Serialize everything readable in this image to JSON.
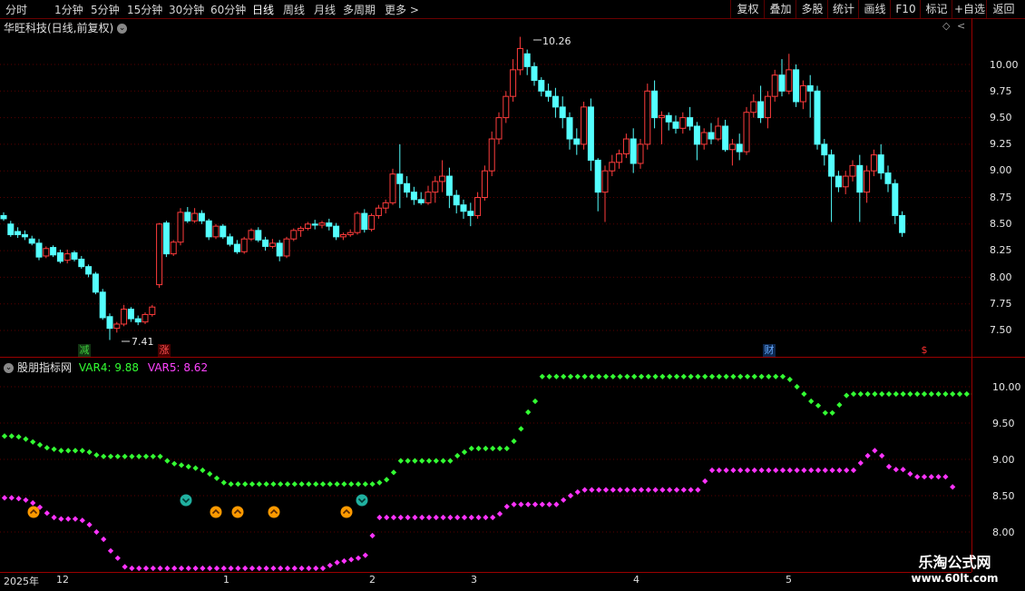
{
  "toolbar": {
    "periods": [
      "分时",
      "1分钟",
      "5分钟",
      "15分钟",
      "30分钟",
      "60分钟",
      "日线",
      "周线",
      "月线",
      "多周期",
      "更多 >"
    ],
    "active_period": "日线",
    "right_buttons": [
      "复权",
      "叠加",
      "多股",
      "统计",
      "画线",
      "F10",
      "标记",
      "+自选",
      "返回"
    ]
  },
  "main_chart": {
    "title": "华旺科技(日线,前复权)",
    "high_label": "10.26",
    "low_label": "7.41",
    "price_axis": [
      "10.00",
      "9.75",
      "9.50",
      "9.25",
      "9.00",
      "8.75",
      "8.50",
      "8.25",
      "8.00",
      "7.75",
      "7.50"
    ],
    "markers": [
      {
        "label": "减",
        "color": "#2ea02e",
        "bg": "#1a4a1a"
      },
      {
        "label": "涨",
        "color": "#ff4040",
        "bg": "#4a0000"
      },
      {
        "label": "财",
        "color": "#5aa0ff",
        "bg": "#102a50"
      },
      {
        "label": "$",
        "color": "#ff3030",
        "bg": "#000000"
      }
    ]
  },
  "indicator": {
    "name": "股朋指标网",
    "var4_label": "VAR4: 9.88",
    "var5_label": "VAR5: 8.62",
    "axis": [
      "10.00",
      "9.50",
      "9.00",
      "8.50",
      "8.00"
    ],
    "colors": {
      "var4": "#33ff33",
      "var5": "#ff33ff"
    }
  },
  "date_axis": [
    "2025年",
    "12",
    "1",
    "2",
    "3",
    "4",
    "5"
  ],
  "watermark": {
    "line1": "乐淘公式网",
    "line2": "www.60lt.com"
  },
  "chart_data": {
    "type": "candlestick",
    "ylim": [
      7.3,
      10.35
    ],
    "candles": [
      [
        8.58,
        8.61,
        8.55,
        8.53
      ],
      [
        8.5,
        8.53,
        8.4,
        8.38
      ],
      [
        8.43,
        8.47,
        8.4,
        8.37
      ],
      [
        8.4,
        8.44,
        8.38,
        8.35
      ],
      [
        8.36,
        8.39,
        8.32,
        8.3
      ],
      [
        8.32,
        8.36,
        8.19,
        8.16
      ],
      [
        8.2,
        8.29,
        8.27,
        8.18
      ],
      [
        8.28,
        8.3,
        8.21,
        8.19
      ],
      [
        8.23,
        8.26,
        8.15,
        8.13
      ],
      [
        8.16,
        8.26,
        8.22,
        8.13
      ],
      [
        8.23,
        8.25,
        8.17,
        8.15
      ],
      [
        8.17,
        8.2,
        8.1,
        8.08
      ],
      [
        8.1,
        8.12,
        8.03,
        8.0
      ],
      [
        8.03,
        8.05,
        7.86,
        7.84
      ],
      [
        7.86,
        7.89,
        7.62,
        7.6
      ],
      [
        7.63,
        7.66,
        7.52,
        7.41
      ],
      [
        7.52,
        7.58,
        7.56,
        7.48
      ],
      [
        7.56,
        7.74,
        7.7,
        7.54
      ],
      [
        7.7,
        7.72,
        7.61,
        7.58
      ],
      [
        7.61,
        7.64,
        7.58,
        7.55
      ],
      [
        7.58,
        7.67,
        7.65,
        7.56
      ],
      [
        7.65,
        7.74,
        7.72,
        7.63
      ],
      [
        7.93,
        8.51,
        8.5,
        7.9
      ],
      [
        8.51,
        8.53,
        8.22,
        8.19
      ],
      [
        8.22,
        8.35,
        8.33,
        8.2
      ],
      [
        8.33,
        8.65,
        8.61,
        8.3
      ],
      [
        8.61,
        8.66,
        8.53,
        8.51
      ],
      [
        8.53,
        8.65,
        8.6,
        8.51
      ],
      [
        8.6,
        8.63,
        8.53,
        8.5
      ],
      [
        8.53,
        8.55,
        8.38,
        8.35
      ],
      [
        8.38,
        8.5,
        8.48,
        8.36
      ],
      [
        8.48,
        8.5,
        8.38,
        8.36
      ],
      [
        8.38,
        8.41,
        8.31,
        8.29
      ],
      [
        8.31,
        8.35,
        8.24,
        8.22
      ],
      [
        8.24,
        8.38,
        8.36,
        8.22
      ],
      [
        8.36,
        8.46,
        8.44,
        8.34
      ],
      [
        8.44,
        8.47,
        8.35,
        8.33
      ],
      [
        8.35,
        8.38,
        8.29,
        8.25
      ],
      [
        8.29,
        8.36,
        8.32,
        8.27
      ],
      [
        8.32,
        8.35,
        8.2,
        8.15
      ],
      [
        8.2,
        8.38,
        8.36,
        8.18
      ],
      [
        8.36,
        8.46,
        8.44,
        8.34
      ],
      [
        8.44,
        8.48,
        8.46,
        8.38
      ],
      [
        8.46,
        8.52,
        8.5,
        8.44
      ],
      [
        8.5,
        8.54,
        8.49,
        8.45
      ],
      [
        8.49,
        8.53,
        8.51,
        8.46
      ],
      [
        8.51,
        8.55,
        8.48,
        8.44
      ],
      [
        8.48,
        8.51,
        8.38,
        8.35
      ],
      [
        8.38,
        8.42,
        8.4,
        8.35
      ],
      [
        8.4,
        8.45,
        8.42,
        8.38
      ],
      [
        8.42,
        8.62,
        8.6,
        8.4
      ],
      [
        8.6,
        8.64,
        8.45,
        8.42
      ],
      [
        8.45,
        8.6,
        8.58,
        8.43
      ],
      [
        8.58,
        8.68,
        8.65,
        8.55
      ],
      [
        8.65,
        8.73,
        8.7,
        8.6
      ],
      [
        8.7,
        9.02,
        8.97,
        8.68
      ],
      [
        8.97,
        9.25,
        8.88,
        8.65
      ],
      [
        8.88,
        8.95,
        8.8,
        8.75
      ],
      [
        8.8,
        8.85,
        8.73,
        8.68
      ],
      [
        8.73,
        8.8,
        8.7,
        8.68
      ],
      [
        8.7,
        8.86,
        8.8,
        8.68
      ],
      [
        8.8,
        8.95,
        8.9,
        8.7
      ],
      [
        8.9,
        9.1,
        8.95,
        8.8
      ],
      [
        8.95,
        9.03,
        8.77,
        8.65
      ],
      [
        8.77,
        8.82,
        8.68,
        8.6
      ],
      [
        8.68,
        8.73,
        8.62,
        8.55
      ],
      [
        8.62,
        8.7,
        8.58,
        8.48
      ],
      [
        8.58,
        8.8,
        8.75,
        8.55
      ],
      [
        8.75,
        9.05,
        9.0,
        8.72
      ],
      [
        9.0,
        9.37,
        9.3,
        8.95
      ],
      [
        9.3,
        9.55,
        9.5,
        9.25
      ],
      [
        9.5,
        9.75,
        9.7,
        9.45
      ],
      [
        9.7,
        10.05,
        9.95,
        9.65
      ],
      [
        9.95,
        10.26,
        10.15,
        9.9
      ],
      [
        10.1,
        10.14,
        9.98,
        9.9
      ],
      [
        9.98,
        10.02,
        9.85,
        9.8
      ],
      [
        9.85,
        9.88,
        9.75,
        9.7
      ],
      [
        9.75,
        9.82,
        9.7,
        9.65
      ],
      [
        9.7,
        9.78,
        9.6,
        9.5
      ],
      [
        9.6,
        9.7,
        9.5,
        9.4
      ],
      [
        9.5,
        9.55,
        9.3,
        9.2
      ],
      [
        9.3,
        9.4,
        9.25,
        9.15
      ],
      [
        9.25,
        9.65,
        9.6,
        9.2
      ],
      [
        9.6,
        9.68,
        9.1,
        9.0
      ],
      [
        9.1,
        9.12,
        8.8,
        8.62
      ],
      [
        8.8,
        9.05,
        9.0,
        8.52
      ],
      [
        9.0,
        9.15,
        9.08,
        8.95
      ],
      [
        9.08,
        9.2,
        9.16,
        9.02
      ],
      [
        9.16,
        9.35,
        9.3,
        9.12
      ],
      [
        9.3,
        9.4,
        9.07,
        8.98
      ],
      [
        9.07,
        9.3,
        9.25,
        9.02
      ],
      [
        9.25,
        9.82,
        9.75,
        9.2
      ],
      [
        9.75,
        9.85,
        9.5,
        9.4
      ],
      [
        9.5,
        9.56,
        9.52,
        9.25
      ],
      [
        9.52,
        9.55,
        9.46,
        9.38
      ],
      [
        9.46,
        9.52,
        9.4,
        9.35
      ],
      [
        9.4,
        9.55,
        9.5,
        9.35
      ],
      [
        9.5,
        9.6,
        9.42,
        9.38
      ],
      [
        9.42,
        9.46,
        9.25,
        9.1
      ],
      [
        9.25,
        9.4,
        9.36,
        9.2
      ],
      [
        9.36,
        9.45,
        9.3,
        9.25
      ],
      [
        9.3,
        9.5,
        9.42,
        9.28
      ],
      [
        9.42,
        9.48,
        9.2,
        9.18
      ],
      [
        9.2,
        9.3,
        9.25,
        9.05
      ],
      [
        9.25,
        9.35,
        9.18,
        9.1
      ],
      [
        9.18,
        9.6,
        9.55,
        9.15
      ],
      [
        9.55,
        9.72,
        9.65,
        9.5
      ],
      [
        9.65,
        9.8,
        9.5,
        9.45
      ],
      [
        9.5,
        9.75,
        9.7,
        9.4
      ],
      [
        9.7,
        9.95,
        9.9,
        9.65
      ],
      [
        9.9,
        10.05,
        9.75,
        9.7
      ],
      [
        9.75,
        10.1,
        9.95,
        9.72
      ],
      [
        9.95,
        10.0,
        9.65,
        9.6
      ],
      [
        9.65,
        9.85,
        9.8,
        9.58
      ],
      [
        9.8,
        9.9,
        9.75,
        9.5
      ],
      [
        9.75,
        9.8,
        9.25,
        9.2
      ],
      [
        9.25,
        9.3,
        9.15,
        9.05
      ],
      [
        9.15,
        9.2,
        8.95,
        8.52
      ],
      [
        8.95,
        9.0,
        8.85,
        8.8
      ],
      [
        8.85,
        9.0,
        8.95,
        8.78
      ],
      [
        8.95,
        9.1,
        9.05,
        8.9
      ],
      [
        9.05,
        9.15,
        8.8,
        8.52
      ],
      [
        8.8,
        9.05,
        9.0,
        8.7
      ],
      [
        9.0,
        9.2,
        9.15,
        8.95
      ],
      [
        9.15,
        9.25,
        8.98,
        8.92
      ],
      [
        8.98,
        9.05,
        8.88,
        8.8
      ],
      [
        8.88,
        8.92,
        8.58,
        8.5
      ],
      [
        8.58,
        8.62,
        8.42,
        8.38
      ]
    ],
    "var4": [
      9.32,
      9.32,
      9.31,
      9.28,
      9.24,
      9.2,
      9.16,
      9.14,
      9.12,
      9.12,
      9.12,
      9.12,
      9.1,
      9.06,
      9.04,
      9.04,
      9.04,
      9.04,
      9.04,
      9.04,
      9.04,
      9.04,
      9.04,
      8.98,
      8.94,
      8.92,
      8.9,
      8.88,
      8.85,
      8.8,
      8.74,
      8.68,
      8.66,
      8.66,
      8.66,
      8.66,
      8.66,
      8.66,
      8.66,
      8.66,
      8.66,
      8.66,
      8.66,
      8.66,
      8.66,
      8.66,
      8.66,
      8.66,
      8.66,
      8.66,
      8.66,
      8.66,
      8.66,
      8.68,
      8.72,
      8.82,
      8.98,
      8.98,
      8.98,
      8.98,
      8.98,
      8.98,
      8.98,
      8.98,
      9.05,
      9.1,
      9.15,
      9.15,
      9.15,
      9.15,
      9.15,
      9.15,
      9.25,
      9.42,
      9.65,
      9.8,
      10.14,
      10.14,
      10.14,
      10.14,
      10.14,
      10.14,
      10.14,
      10.14,
      10.14,
      10.14,
      10.14,
      10.14,
      10.14,
      10.14,
      10.14,
      10.14,
      10.14,
      10.14,
      10.14,
      10.14,
      10.14,
      10.14,
      10.14,
      10.14,
      10.14,
      10.14,
      10.14,
      10.14,
      10.14,
      10.14,
      10.14,
      10.14,
      10.14,
      10.14,
      10.14,
      10.1,
      10.0,
      9.9,
      9.8,
      9.74,
      9.64,
      9.64,
      9.75,
      9.88,
      9.9,
      9.9,
      9.9,
      9.9,
      9.9,
      9.9,
      9.9,
      9.9,
      9.9,
      9.9,
      9.9,
      9.9,
      9.9,
      9.9,
      9.9,
      9.9,
      9.9,
      9.9,
      9.9
    ],
    "var5": [
      8.47,
      8.47,
      8.46,
      8.44,
      8.4,
      8.34,
      8.26,
      8.2,
      8.18,
      8.18,
      8.18,
      8.16,
      8.1,
      8.0,
      7.9,
      7.74,
      7.64,
      7.52,
      7.5,
      7.5,
      7.5,
      7.5,
      7.5,
      7.5,
      7.5,
      7.5,
      7.5,
      7.5,
      7.5,
      7.5,
      7.5,
      7.5,
      7.5,
      7.5,
      7.5,
      7.5,
      7.5,
      7.5,
      7.5,
      7.5,
      7.5,
      7.5,
      7.5,
      7.5,
      7.5,
      7.5,
      7.54,
      7.58,
      7.6,
      7.62,
      7.64,
      7.68,
      7.95,
      8.2,
      8.2,
      8.2,
      8.2,
      8.2,
      8.2,
      8.2,
      8.2,
      8.2,
      8.2,
      8.2,
      8.2,
      8.2,
      8.2,
      8.2,
      8.2,
      8.2,
      8.25,
      8.35,
      8.38,
      8.38,
      8.38,
      8.38,
      8.38,
      8.38,
      8.38,
      8.44,
      8.5,
      8.55,
      8.58,
      8.58,
      8.58,
      8.58,
      8.58,
      8.58,
      8.58,
      8.58,
      8.58,
      8.58,
      8.58,
      8.58,
      8.58,
      8.58,
      8.58,
      8.58,
      8.58,
      8.7,
      8.85,
      8.85,
      8.85,
      8.85,
      8.85,
      8.85,
      8.85,
      8.85,
      8.85,
      8.85,
      8.85,
      8.85,
      8.85,
      8.85,
      8.85,
      8.85,
      8.85,
      8.85,
      8.85,
      8.85,
      8.85,
      8.95,
      9.05,
      9.12,
      9.05,
      8.9,
      8.86,
      8.86,
      8.8,
      8.76,
      8.76,
      8.76,
      8.76,
      8.76,
      8.62
    ]
  }
}
